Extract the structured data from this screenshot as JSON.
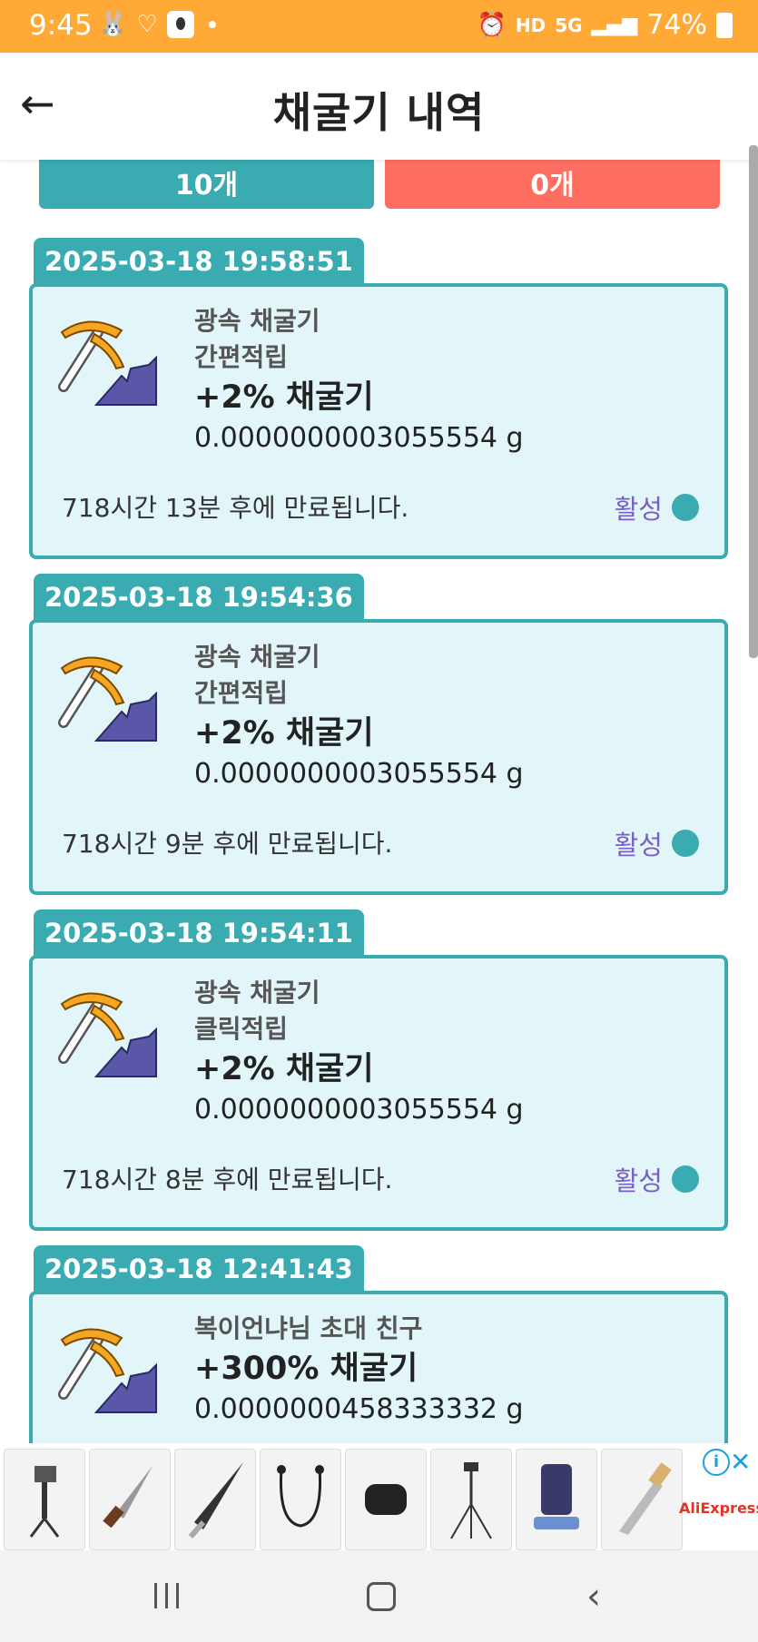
{
  "status_bar": {
    "time": "9:45",
    "network_label": "HD",
    "network_sub": "5G",
    "battery": "74%"
  },
  "header": {
    "title": "채굴기 내역",
    "back_icon": "←"
  },
  "counters": {
    "active": "10개",
    "expired": "0개"
  },
  "entries": [
    {
      "timestamp": "2025-03-18 19:58:51",
      "name": "광속 채굴기",
      "type": "간편적립",
      "boost": "+2% 채굴기",
      "amount": "0.0000000003055554 g",
      "expires": "718시간 13분 후에 만료됩니다.",
      "status": "활성"
    },
    {
      "timestamp": "2025-03-18 19:54:36",
      "name": "광속 채굴기",
      "type": "간편적립",
      "boost": "+2% 채굴기",
      "amount": "0.0000000003055554 g",
      "expires": "718시간 9분 후에 만료됩니다.",
      "status": "활성"
    },
    {
      "timestamp": "2025-03-18 19:54:11",
      "name": "광속 채굴기",
      "type": "클릭적립",
      "boost": "+2% 채굴기",
      "amount": "0.0000000003055554 g",
      "expires": "718시간 8분 후에 만료됩니다.",
      "status": "활성"
    },
    {
      "timestamp": "2025-03-18 12:41:43",
      "name": "복이언냐님 초대 친구",
      "boost": "+300% 채굴기",
      "amount": "0.0000000458333332 g"
    }
  ],
  "ad": {
    "brand": "AliExpress",
    "info_icon": "i",
    "close_icon": "✕"
  },
  "colors": {
    "status_bar": "#ffa936",
    "teal": "#3aabb1",
    "red": "#ff6f61",
    "card_bg": "#e2f6f9",
    "status_label": "#7b5fc4"
  }
}
